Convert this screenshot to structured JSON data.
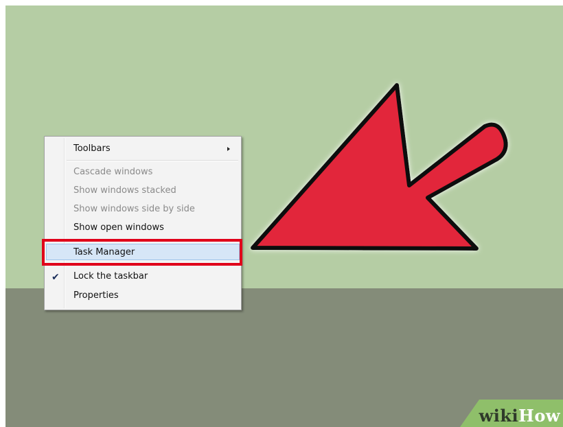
{
  "context_menu": {
    "items": [
      {
        "label": "Toolbars",
        "state": "normal",
        "has_submenu": true
      },
      {
        "label": "Cascade windows",
        "state": "disabled"
      },
      {
        "label": "Show windows stacked",
        "state": "disabled"
      },
      {
        "label": "Show windows side by side",
        "state": "disabled"
      },
      {
        "label": "Show open windows",
        "state": "normal"
      },
      {
        "label": "Task Manager",
        "state": "highlighted"
      },
      {
        "label": "Lock the taskbar",
        "state": "checked"
      },
      {
        "label": "Properties",
        "state": "normal"
      }
    ]
  },
  "icons": {
    "submenu": "chevron-right-icon",
    "checkmark": "checkmark-icon"
  },
  "check_glyph": "✔",
  "annotation": {
    "highlight_color": "#e0001a",
    "arrow_color": "#e2263b"
  },
  "watermark": {
    "part1": "wiki",
    "part2": "How"
  },
  "colors": {
    "desktop": "#b5cda4",
    "taskbar": "#848c79",
    "menu_bg": "#f3f3f3",
    "highlight_bg": "#d6e6f7"
  }
}
